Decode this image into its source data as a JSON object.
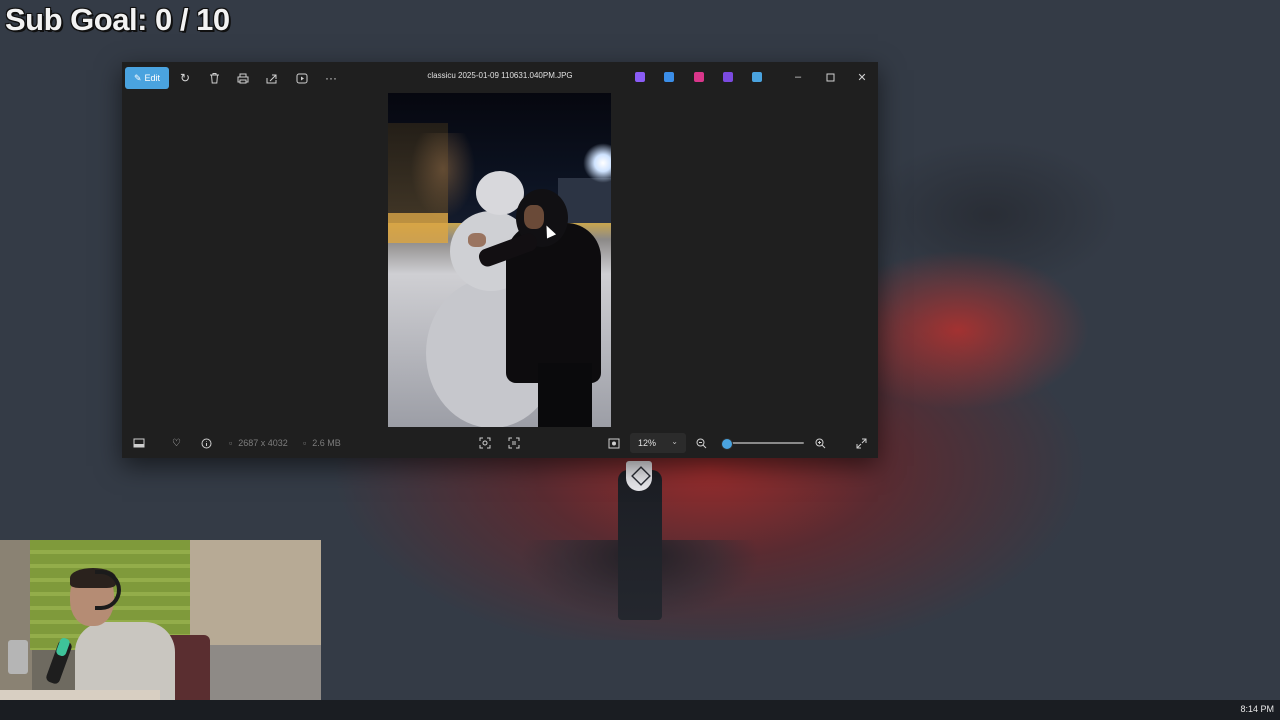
{
  "overlay": {
    "sub_goal": "Sub Goal:  0 / 10"
  },
  "window": {
    "file_name": "classicu 2025-01-09 110631.040PM.JPG",
    "toolbar": {
      "edit_label": "Edit",
      "more_label": "···"
    },
    "app_icons": [
      {
        "name": "copilot-icon",
        "color": "#8a5cf6"
      },
      {
        "name": "image-creator-icon",
        "color": "#3b8ee8"
      },
      {
        "name": "designer-icon",
        "color": "#d9368a"
      },
      {
        "name": "clipchamp-icon",
        "color": "#7b4ae0"
      },
      {
        "name": "onedrive-icon",
        "color": "#4aa3df"
      }
    ],
    "status": {
      "dimensions": "2687 x 4032",
      "file_size": "2.6 MB",
      "zoom": "12%",
      "zoom_slider_fraction": 0.03
    },
    "accent_color": "#4aa3df"
  },
  "taskbar": {
    "time": "8:14 PM"
  }
}
